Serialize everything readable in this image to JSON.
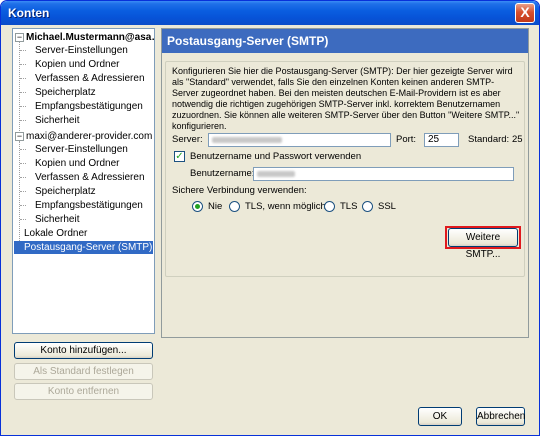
{
  "window": {
    "title": "Konten",
    "close_glyph": "X"
  },
  "tree": {
    "accounts": [
      {
        "label": "Michael.Mustermann@asa…",
        "expander": "−",
        "children": [
          "Server-Einstellungen",
          "Kopien und Ordner",
          "Verfassen & Adressieren",
          "Speicherplatz",
          "Empfangsbestätigungen",
          "Sicherheit"
        ]
      },
      {
        "label": "maxi@anderer-provider.com",
        "expander": "−",
        "children": [
          "Server-Einstellungen",
          "Kopien und Ordner",
          "Verfassen & Adressieren",
          "Speicherplatz",
          "Empfangsbestätigungen",
          "Sicherheit"
        ]
      }
    ],
    "local_folders": "Lokale Ordner",
    "smtp_item": "Postausgang-Server (SMTP)"
  },
  "side_buttons": {
    "add_account": "Konto hinzufügen...",
    "set_default": "Als Standard festlegen",
    "remove_account": "Konto entfernen"
  },
  "panel": {
    "header": "Postausgang-Server (SMTP)",
    "description": "Konfigurieren Sie hier die Postausgang-Server (SMTP): Der hier gezeigte Server wird als \"Standard\" verwendet, falls Sie den einzelnen Konten keinen anderen SMTP-Server zugeordnet haben. Bei den meisten deutschen E-Mail-Providern ist es aber notwendig die richtigen zugehörigen SMTP-Server inkl. korrektem Benutzernamen zuzuordnen. Sie können alle weiteren SMTP-Server über den Button \"Weitere SMTP...\" konfigurieren.",
    "server_label": "Server:",
    "port_label": "Port:",
    "port_value": "25",
    "standard_label": "Standard:",
    "standard_value": "25",
    "auth_checkbox": "Benutzername und Passwort verwenden",
    "auth_checked": true,
    "username_label": "Benutzername:",
    "secure_label": "Sichere Verbindung verwenden:",
    "security_options": [
      "Nie",
      "TLS, wenn möglich",
      "TLS",
      "SSL"
    ],
    "security_selected": "Nie",
    "more_smtp_button": "Weitere SMTP..."
  },
  "footer": {
    "ok": "OK",
    "cancel": "Abbrechen"
  },
  "colors": {
    "accent": "#316ac5",
    "panel_header": "#3d6bbf",
    "highlight_frame": "#e0191d",
    "check": "#21a121"
  }
}
